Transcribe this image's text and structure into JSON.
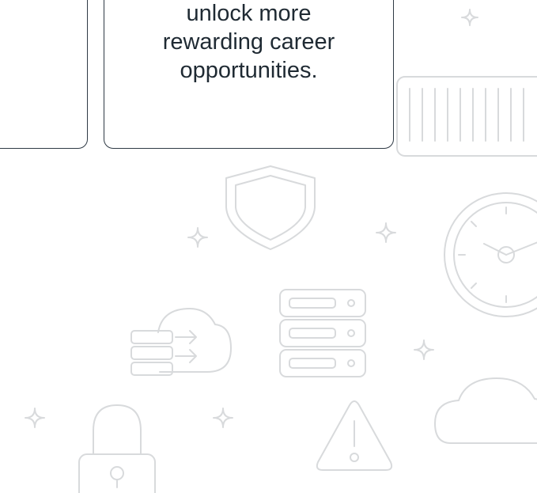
{
  "promo_card": {
    "lines": [
      "unlock more",
      "rewarding career",
      "opportunities."
    ]
  },
  "colors": {
    "background": "#ffffff",
    "card_border": "#2f3a45",
    "card_text": "#1f2a33",
    "illustration_stroke": "#d8dadc"
  },
  "decorations": [
    "sparkle-icon",
    "server-rack-icon",
    "shield-icon",
    "clock-icon",
    "cloud-transfer-icon",
    "database-server-icon",
    "warning-triangle-icon",
    "padlock-icon",
    "cloud-icon"
  ]
}
